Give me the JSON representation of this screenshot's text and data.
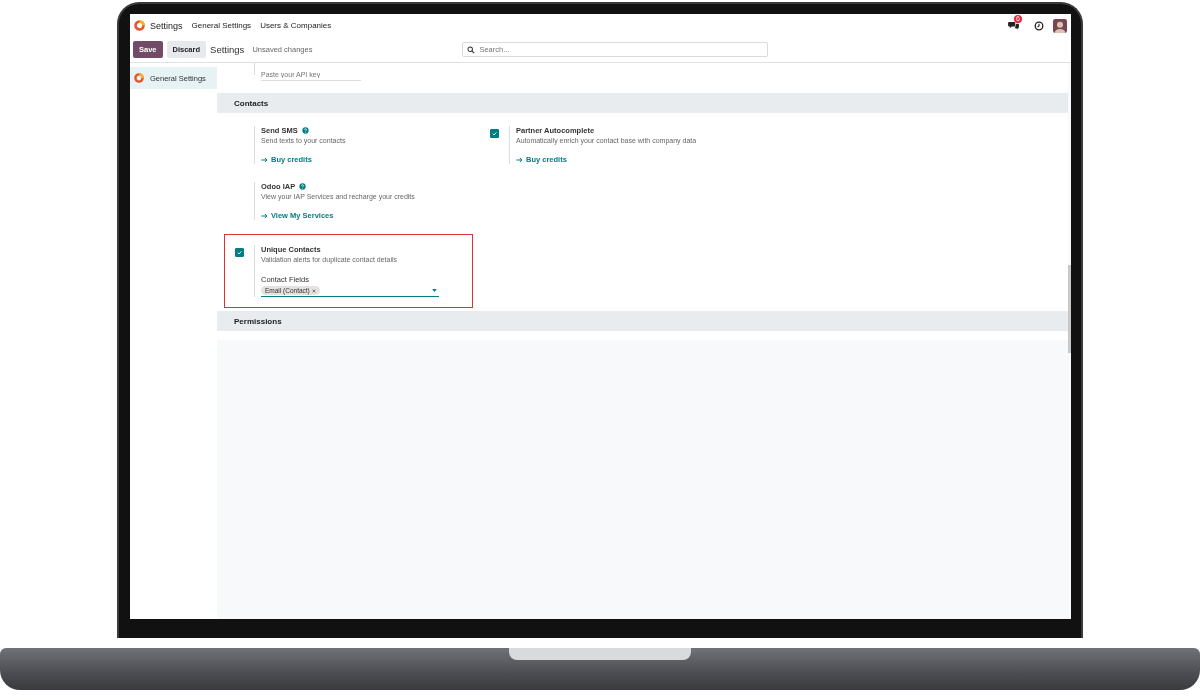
{
  "navbar": {
    "app": "Settings",
    "menus": [
      "General Settings",
      "Users & Companies"
    ],
    "messages_badge": "6"
  },
  "control_panel": {
    "buttons": [
      {
        "label": "Save",
        "kind": "primary"
      },
      {
        "label": "Discard",
        "kind": "secondary"
      }
    ],
    "title": "Settings",
    "status": "Unsaved changes",
    "search": {
      "placeholder": "Search..."
    }
  },
  "sidebar": {
    "items": [
      {
        "label": "General Settings",
        "selected": true
      }
    ]
  },
  "previous_field": {
    "placeholder": "Paste your API key"
  },
  "sections": [
    {
      "title": "Contacts",
      "settings": [
        {
          "kind": "plain",
          "title": "Send SMS",
          "help": true,
          "highlighted": false,
          "description": "Send texts to your contacts",
          "link": "Buy credits"
        },
        {
          "kind": "checkbox",
          "checked": true,
          "title": "Partner Autocomplete",
          "help": false,
          "highlighted": false,
          "description": "Automatically enrich your contact base with company data",
          "link": "Buy credits"
        },
        {
          "kind": "plain",
          "title": "Odoo IAP",
          "help": true,
          "highlighted": false,
          "description": "View your IAP Services and recharge your credits",
          "link": "View My Services"
        },
        {
          "kind": "checkbox",
          "checked": true,
          "title": "Unique Contacts",
          "help": false,
          "highlighted": true,
          "description": "Validation alerts for duplicate contact details",
          "field": {
            "label": "Contact Fields",
            "tags": [
              "Email (Contact)"
            ]
          }
        }
      ]
    },
    {
      "title": "Permissions"
    }
  ]
}
